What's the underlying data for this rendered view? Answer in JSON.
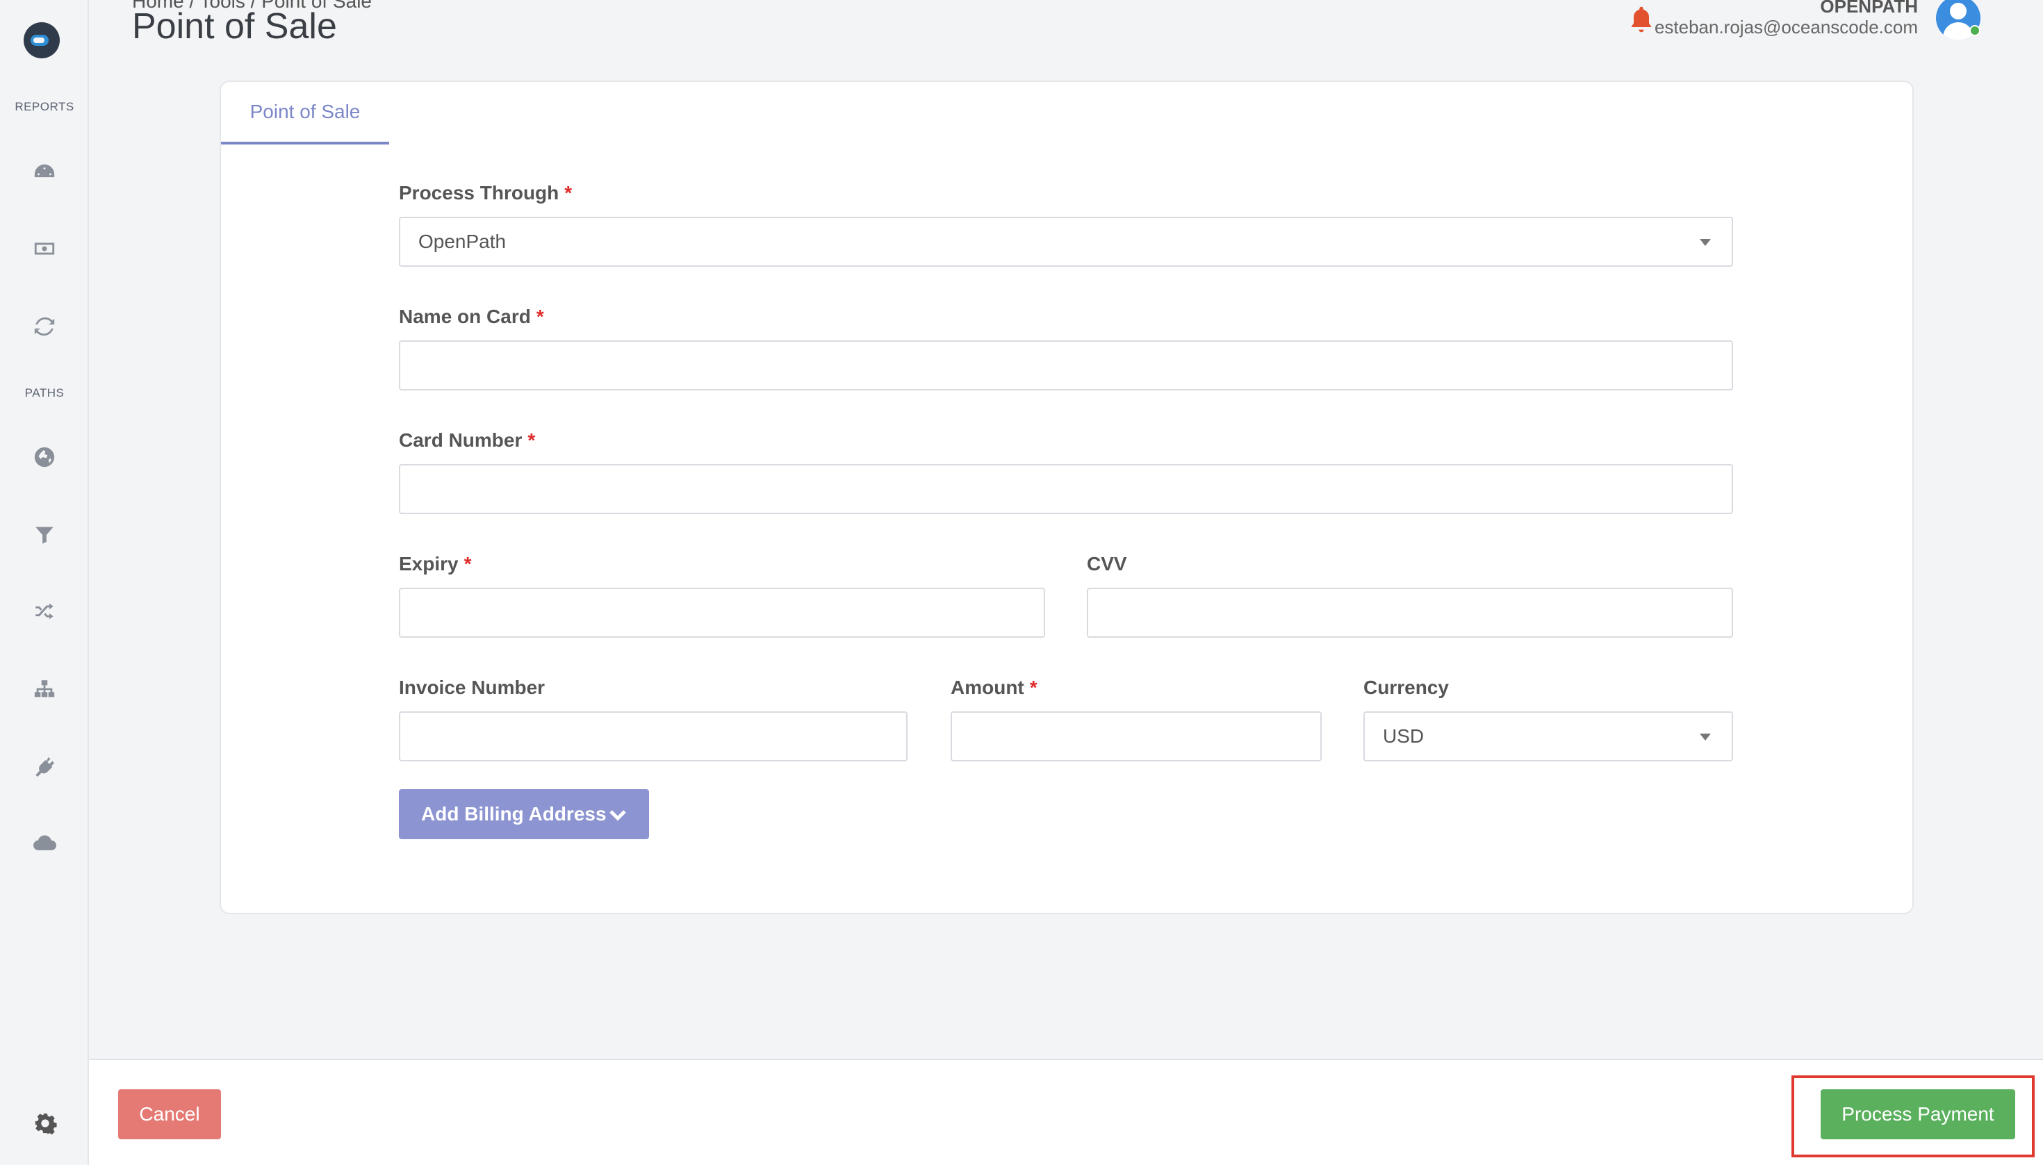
{
  "sidebar": {
    "sections": {
      "reports": "REPORTS",
      "paths": "PATHS"
    },
    "icons": [
      "dashboard-icon",
      "money-icon",
      "refresh-icon",
      "globe-icon",
      "filter-icon",
      "shuffle-icon",
      "sitemap-icon",
      "plug-icon",
      "cloud-icon",
      "settings-gear-icon"
    ]
  },
  "header": {
    "breadcrumb": "Home  /  Tools  /  Point of Sale",
    "title": "Point of Sale",
    "org": "OPENPATH",
    "email": "esteban.rojas@oceanscode.com"
  },
  "tab": {
    "label": "Point of Sale"
  },
  "form": {
    "process_through": {
      "label": "Process Through",
      "value": "OpenPath"
    },
    "name_on_card": {
      "label": "Name on Card",
      "value": ""
    },
    "card_number": {
      "label": "Card Number",
      "value": ""
    },
    "expiry": {
      "label": "Expiry",
      "value": ""
    },
    "cvv": {
      "label": "CVV",
      "value": ""
    },
    "invoice_number": {
      "label": "Invoice Number",
      "value": ""
    },
    "amount": {
      "label": "Amount",
      "value": ""
    },
    "currency": {
      "label": "Currency",
      "value": "USD"
    },
    "required_marker": "*",
    "billing_button": "Add Billing Address"
  },
  "footer": {
    "cancel": "Cancel",
    "process": "Process Payment"
  },
  "colors": {
    "accent": "#7b86c7",
    "danger": "#e57a75",
    "success": "#5ab05d",
    "required": "#e02b2b",
    "highlight": "#e03a2f"
  }
}
